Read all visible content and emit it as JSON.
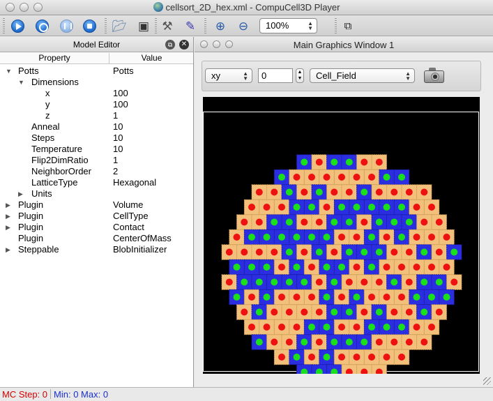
{
  "window": {
    "title": "cellsort_2D_hex.xml - CompuCell3D Player"
  },
  "toolbar": {
    "buttons": [
      "run",
      "step",
      "pause",
      "stop",
      "open",
      "save",
      "configure",
      "edit",
      "zoom-in",
      "zoom-out"
    ],
    "zoom": "100%"
  },
  "model_editor": {
    "title": "Model Editor",
    "columns": {
      "property": "Property",
      "value": "Value"
    },
    "rows": [
      {
        "depth": 0,
        "toggle": "▼",
        "prop": "Potts",
        "val": "Potts"
      },
      {
        "depth": 1,
        "toggle": "▼",
        "prop": "Dimensions",
        "val": ""
      },
      {
        "depth": 2,
        "toggle": "",
        "prop": "x",
        "val": "100"
      },
      {
        "depth": 2,
        "toggle": "",
        "prop": "y",
        "val": "100"
      },
      {
        "depth": 2,
        "toggle": "",
        "prop": "z",
        "val": "1"
      },
      {
        "depth": 1,
        "toggle": "",
        "prop": "Anneal",
        "val": "10"
      },
      {
        "depth": 1,
        "toggle": "",
        "prop": "Steps",
        "val": "10"
      },
      {
        "depth": 1,
        "toggle": "",
        "prop": "Temperature",
        "val": "10"
      },
      {
        "depth": 1,
        "toggle": "",
        "prop": "Flip2DimRatio",
        "val": "1"
      },
      {
        "depth": 1,
        "toggle": "",
        "prop": "NeighborOrder",
        "val": "2"
      },
      {
        "depth": 1,
        "toggle": "",
        "prop": "LatticeType",
        "val": "Hexagonal"
      },
      {
        "depth": 1,
        "toggle": "▶",
        "prop": "Units",
        "val": ""
      },
      {
        "depth": 0,
        "toggle": "▶",
        "prop": "Plugin",
        "val": "Volume"
      },
      {
        "depth": 0,
        "toggle": "▶",
        "prop": "Plugin",
        "val": "CellType"
      },
      {
        "depth": 0,
        "toggle": "▶",
        "prop": "Plugin",
        "val": "Contact"
      },
      {
        "depth": 0,
        "toggle": "",
        "prop": "Plugin",
        "val": "CenterOfMass"
      },
      {
        "depth": 0,
        "toggle": "▶",
        "prop": "Steppable",
        "val": "BlobInitializer"
      }
    ]
  },
  "graphics_window": {
    "title": "Main Graphics Window 1",
    "plane": "xy",
    "slice": "0",
    "field": "Cell_Field",
    "colors": {
      "medium": "#000000",
      "condensing": "#f2c07a",
      "non_condensing": "#2a2ee0",
      "dot_on_condensing": "#ee1111",
      "dot_on_non_condensing": "#19e01a"
    }
  },
  "status": {
    "mc_step": "MC Step: 0",
    "minmax": "Min: 0 Max: 0"
  }
}
